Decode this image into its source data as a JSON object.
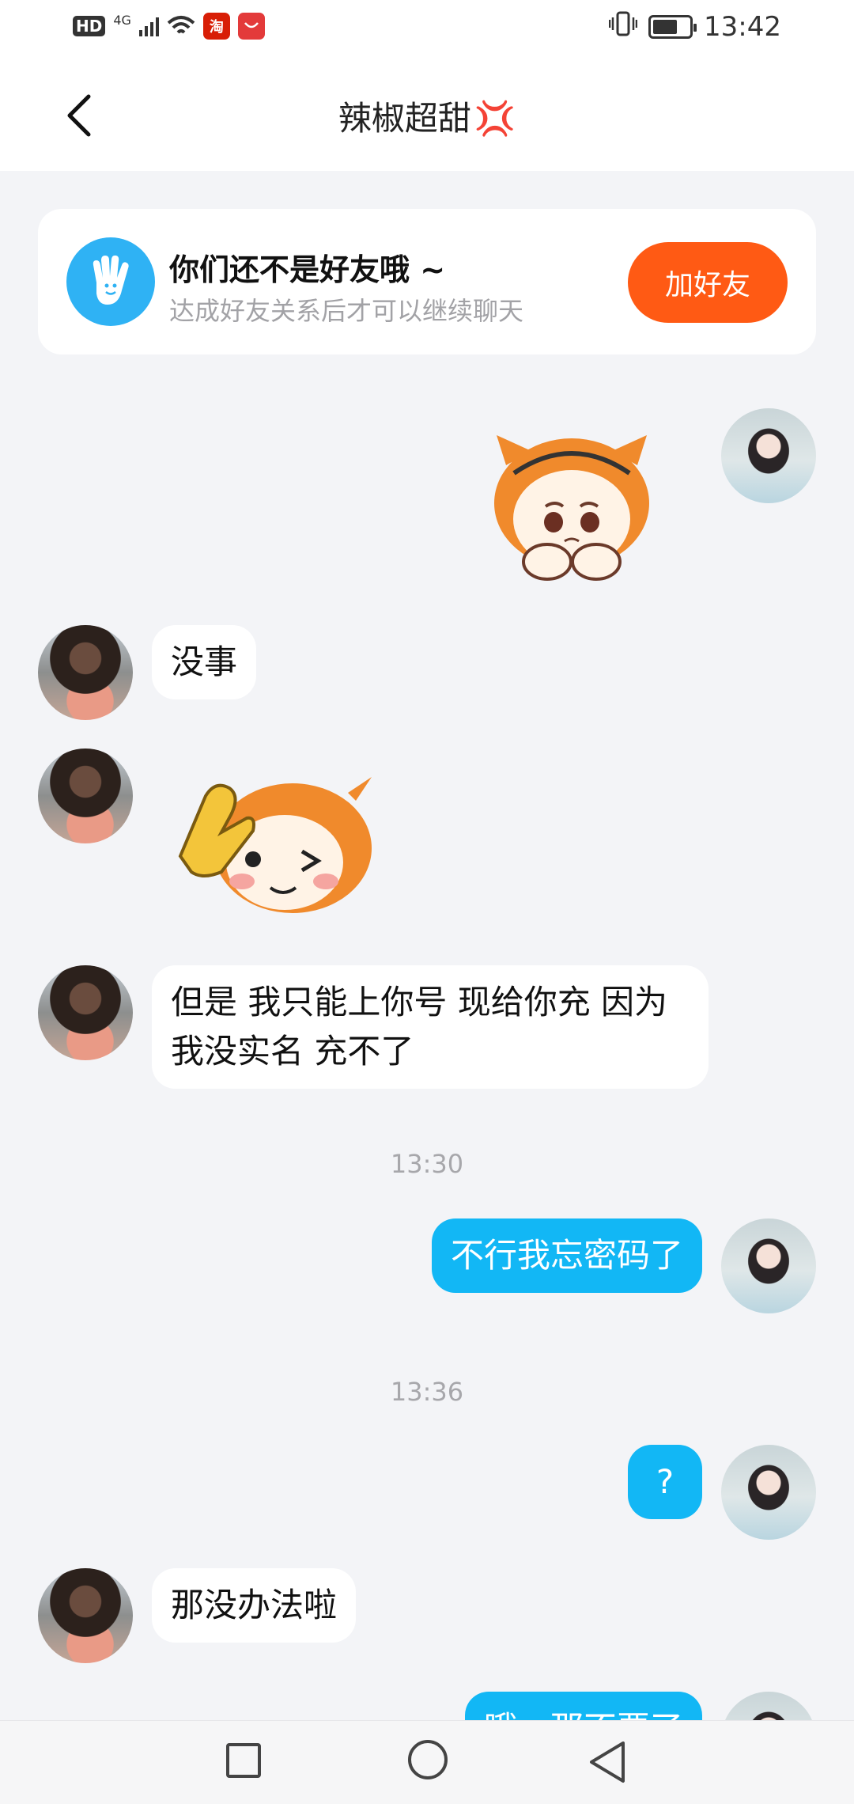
{
  "status_bar": {
    "hd": "HD",
    "network": "4G",
    "app1": "淘",
    "time": "13:42"
  },
  "header": {
    "title": "辣椒超甜",
    "title_emoji": "💢"
  },
  "friend_card": {
    "title": "你们还不是好友哦 ~",
    "subtitle": "达成好友关系后才可以继续聊天",
    "button": "加好友"
  },
  "messages": [
    {
      "side": "me",
      "type": "sticker",
      "sticker": "sad-orange-character-sticker"
    },
    {
      "side": "peer",
      "type": "text",
      "text": "没事"
    },
    {
      "side": "peer",
      "type": "sticker",
      "sticker": "winking-orange-character-sticker"
    },
    {
      "side": "peer",
      "type": "text",
      "text": "但是 我只能上你号 现给你充 因为我没实名 充不了"
    },
    {
      "type": "time",
      "text": "13:30"
    },
    {
      "side": "me",
      "type": "text",
      "text": "不行我忘密码了"
    },
    {
      "type": "time",
      "text": "13:36"
    },
    {
      "side": "me",
      "type": "text",
      "text": "?"
    },
    {
      "side": "peer",
      "type": "text",
      "text": "那没办法啦"
    },
    {
      "side": "me",
      "type": "text",
      "text": "哦，那不要了"
    }
  ],
  "colors": {
    "accent_blue": "#12b7f5",
    "add_button": "#ff5a14",
    "background": "#f3f4f7"
  }
}
